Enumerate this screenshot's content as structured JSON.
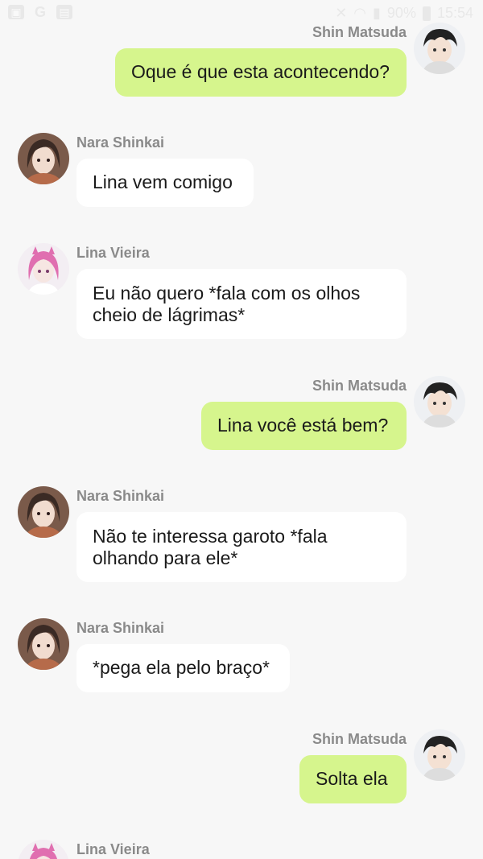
{
  "status_bar": {
    "left_icons": [
      "gallery-icon",
      "google-icon",
      "notification-icon"
    ],
    "battery": "90%",
    "time": "15:54"
  },
  "messages": [
    {
      "sender": "Shin Matsuda",
      "text": "Oque é que esta acontecendo?",
      "side": "right"
    },
    {
      "sender": "Nara Shinkai",
      "text": "Lina vem comigo",
      "side": "left"
    },
    {
      "sender": "Lina Vieira",
      "text": "Eu não quero *fala com os olhos cheio de lágrimas*",
      "side": "left"
    },
    {
      "sender": "Shin Matsuda",
      "text": "Lina você está bem?",
      "side": "right"
    },
    {
      "sender": "Nara Shinkai",
      "text": "Não te interessa garoto *fala olhando para ele*",
      "side": "left"
    },
    {
      "sender": "Nara Shinkai",
      "text": "*pega ela pelo braço*",
      "side": "left"
    },
    {
      "sender": "Shin Matsuda",
      "text": "Solta ela",
      "side": "right"
    },
    {
      "sender": "Lina Vieira",
      "text": "",
      "side": "left"
    }
  ],
  "colors": {
    "background": "#f7f7f7",
    "incoming_bubble": "#ffffff",
    "outgoing_bubble": "#d6f58d",
    "name_text": "#8a8a8a",
    "message_text": "#1a1a1a"
  }
}
